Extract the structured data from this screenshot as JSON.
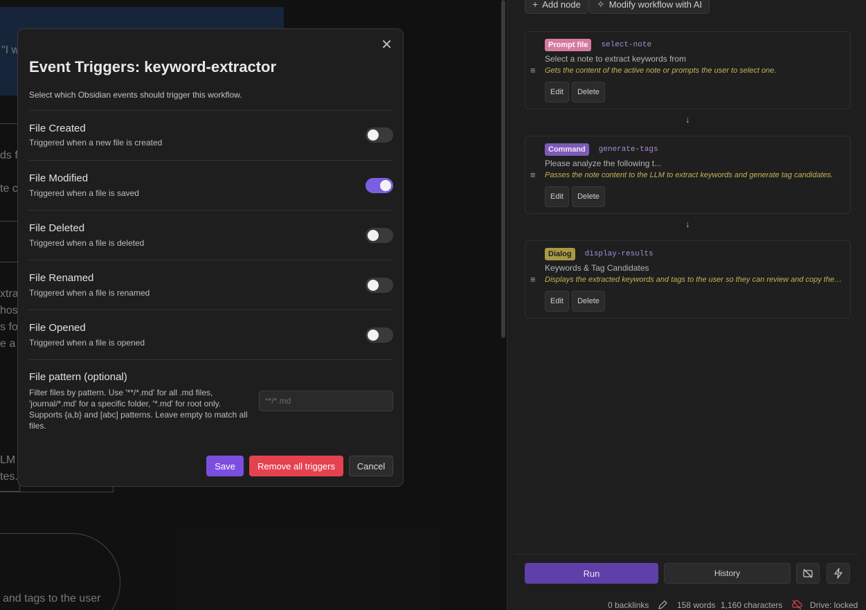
{
  "background": {
    "fragments": [
      "\"I w",
      "ds f",
      "te c",
      "xtra",
      "hos",
      "s for",
      "e a b",
      "LM",
      "tes.",
      "and tags to the user"
    ]
  },
  "workflow": {
    "add_node": "Add node",
    "modify_ai": "Modify workflow with AI",
    "nodes": [
      {
        "type": "Prompt file",
        "id": "select-note",
        "title": "Select a note to extract keywords from",
        "description": "Gets the content of the active note or prompts the user to select one.",
        "edit": "Edit",
        "delete": "Delete"
      },
      {
        "type": "Command",
        "id": "generate-tags",
        "title": "Please analyze the following t...",
        "description": "Passes the note content to the LLM to extract keywords and generate tag candidates.",
        "edit": "Edit",
        "delete": "Delete"
      },
      {
        "type": "Dialog",
        "id": "display-results",
        "title": "Keywords & Tag Candidates",
        "description": "Displays the extracted keywords and tags to the user so they can review and copy them.",
        "edit": "Edit",
        "delete": "Delete"
      }
    ],
    "arrow": "↓",
    "run": "Run",
    "history": "History"
  },
  "status_bar": {
    "backlinks": "0 backlinks",
    "words": "158 words",
    "characters": "1,160 characters",
    "drive": "Drive: locked"
  },
  "modal": {
    "title": "Event Triggers: keyword-extractor",
    "subtitle": "Select which Obsidian events should trigger this workflow.",
    "triggers": [
      {
        "name": "File Created",
        "desc": "Triggered when a new file is created",
        "enabled": false
      },
      {
        "name": "File Modified",
        "desc": "Triggered when a file is saved",
        "enabled": true
      },
      {
        "name": "File Deleted",
        "desc": "Triggered when a file is deleted",
        "enabled": false
      },
      {
        "name": "File Renamed",
        "desc": "Triggered when a file is renamed",
        "enabled": false
      },
      {
        "name": "File Opened",
        "desc": "Triggered when a file is opened",
        "enabled": false
      }
    ],
    "pattern": {
      "title": "File pattern (optional)",
      "desc": "Filter files by pattern. Use '**/*.md' for all .md files, 'journal/*.md' for a specific folder, '*.md' for root only. Supports {a,b} and [abc] patterns. Leave empty to match all files.",
      "placeholder": "**/*.md",
      "value": ""
    },
    "save": "Save",
    "remove": "Remove all triggers",
    "cancel": "Cancel"
  },
  "icons": {
    "close": "close-icon",
    "drag": "drag-handle-icon",
    "sparkle": "sparkle-icon",
    "plus": "plus-icon",
    "pencil": "pencil-icon",
    "sync_off": "sync-off-icon",
    "lightning": "lightning-icon",
    "no_camera": "camera-off-icon"
  },
  "colors": {
    "accent": "#7c4ee0",
    "danger": "#e5424f",
    "run": "#5f3fa8",
    "prompt_badge": "#d57ba0",
    "command_badge": "#7c5bb6",
    "dialog_badge": "#a89a45",
    "node_desc": "#c3b454",
    "node_id": "#a88cd8"
  }
}
